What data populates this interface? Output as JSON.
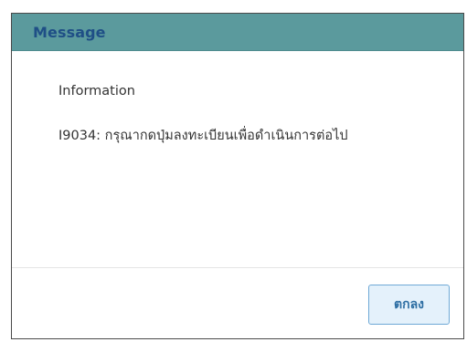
{
  "dialog": {
    "title": "Message",
    "heading": "Information",
    "message": "I9034: กรุณากดปุ่มลงทะเบียนเพื่อดำเนินการต่อไป",
    "ok_label": "ตกลง"
  },
  "colors": {
    "titlebar_bg": "#5b9a9d",
    "title_text": "#1f4f86",
    "button_bg": "#e4f1fb",
    "button_border": "#6fa9d6",
    "button_text": "#2d6ea3"
  }
}
